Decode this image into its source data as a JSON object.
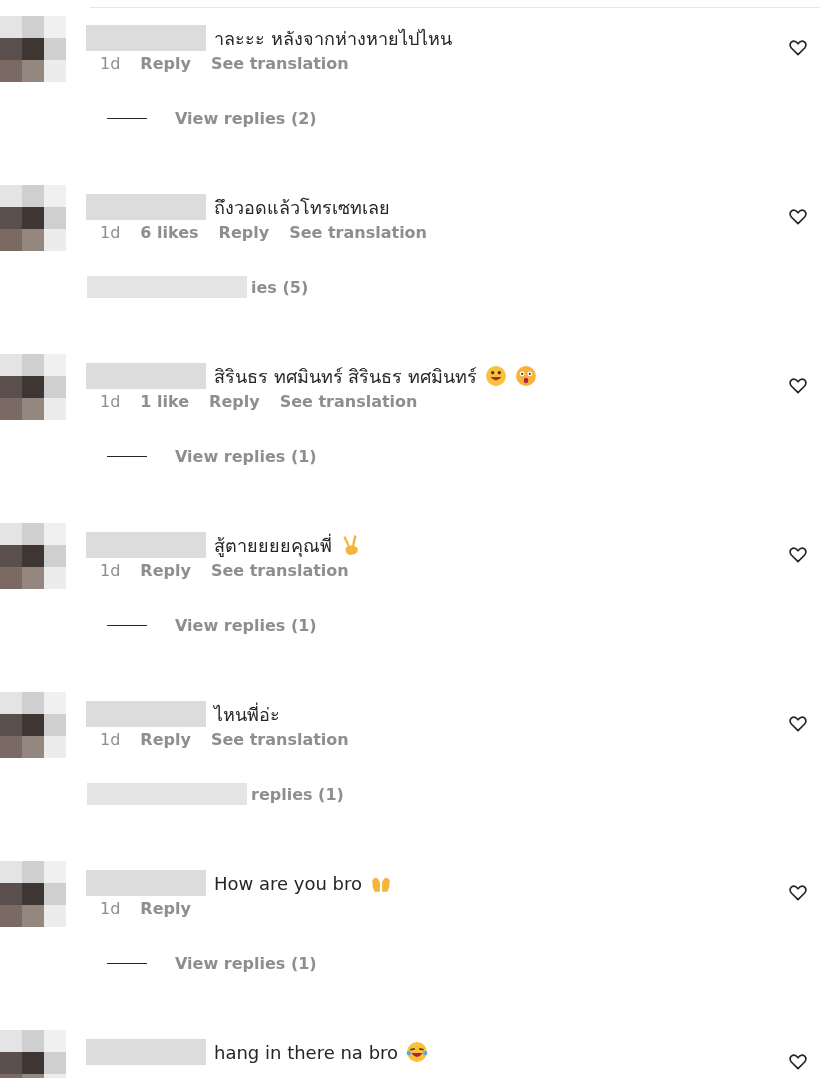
{
  "comments": [
    {
      "text": "าละะะ หลังจากห่างหายไปไหน",
      "meta": [
        "1d",
        "Reply",
        "See translation"
      ],
      "replies": {
        "kind": "line",
        "label": "View replies (2)"
      }
    },
    {
      "text": "ถึงวอดแล้วโทรเซทเลย",
      "meta": [
        "1d",
        "6 likes",
        "Reply",
        "See translation"
      ],
      "replies": {
        "kind": "blurred",
        "label": "ies (5)"
      }
    },
    {
      "text": "สิรินธร ทศมินทร์ สิรินธร ทศมินทร์",
      "emojis": [
        {
          "kind": "grin"
        },
        {
          "kind": "astonished"
        }
      ],
      "meta": [
        "1d",
        "1 like",
        "Reply",
        "See translation"
      ],
      "replies": {
        "kind": "line",
        "label": "View replies (1)"
      }
    },
    {
      "text": "สู้ตายยยยคุณพี่",
      "emojis": [
        {
          "kind": "victory"
        }
      ],
      "meta": [
        "1d",
        "Reply",
        "See translation"
      ],
      "replies": {
        "kind": "line",
        "label": "View replies (1)"
      }
    },
    {
      "text": "ไหนพี่อ่ะ",
      "meta": [
        "1d",
        "Reply",
        "See translation"
      ],
      "replies": {
        "kind": "blurred",
        "label": "replies (1)"
      }
    },
    {
      "text": "How are you bro",
      "emojis": [
        {
          "kind": "raised-hands"
        }
      ],
      "meta": [
        "1d",
        "Reply"
      ],
      "replies": {
        "kind": "line",
        "label": "View replies (1)"
      }
    },
    {
      "text": "hang in there na bro",
      "emojis": [
        {
          "kind": "tears-of-joy"
        }
      ]
    }
  ]
}
